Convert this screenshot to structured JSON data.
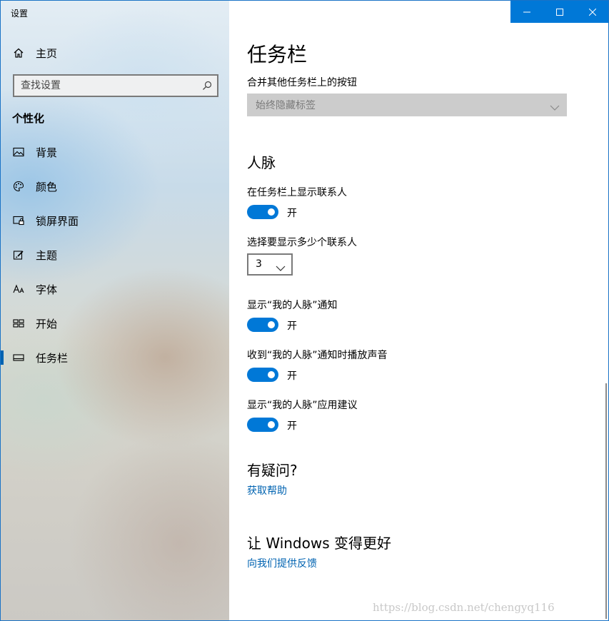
{
  "window": {
    "title": "设置"
  },
  "sidebar": {
    "home_label": "主页",
    "search": {
      "placeholder": "查找设置",
      "value": ""
    },
    "section_title": "个性化",
    "items": [
      {
        "label": "背景",
        "icon": "picture-icon"
      },
      {
        "label": "颜色",
        "icon": "palette-icon"
      },
      {
        "label": "锁屏界面",
        "icon": "lock-screen-icon"
      },
      {
        "label": "主题",
        "icon": "theme-icon"
      },
      {
        "label": "字体",
        "icon": "font-icon"
      },
      {
        "label": "开始",
        "icon": "start-icon"
      },
      {
        "label": "任务栏",
        "icon": "taskbar-icon",
        "active": true
      }
    ]
  },
  "main": {
    "page_title": "任务栏",
    "combine_buttons": {
      "label": "合并其他任务栏上的按钮",
      "value": "始终隐藏标签"
    },
    "people": {
      "title": "人脉",
      "show_contacts": {
        "label": "在任务栏上显示联系人",
        "state": "开",
        "on": true
      },
      "contacts_count": {
        "label": "选择要显示多少个联系人",
        "value": "3"
      },
      "show_notifications": {
        "label": "显示“我的人脉”通知",
        "state": "开",
        "on": true
      },
      "play_sound": {
        "label": "收到“我的人脉”通知时播放声音",
        "state": "开",
        "on": true
      },
      "show_suggestions": {
        "label": "显示“我的人脉”应用建议",
        "state": "开",
        "on": true
      }
    },
    "questions": {
      "title": "有疑问?",
      "link": "获取帮助"
    },
    "feedback": {
      "title": "让 Windows 变得更好",
      "link": "向我们提供反馈"
    }
  },
  "watermark": "https://blog.csdn.net/chengyq116",
  "colors": {
    "accent": "#0078d7",
    "link": "#0063b1",
    "disabled_dropdown": "#cccccc"
  }
}
